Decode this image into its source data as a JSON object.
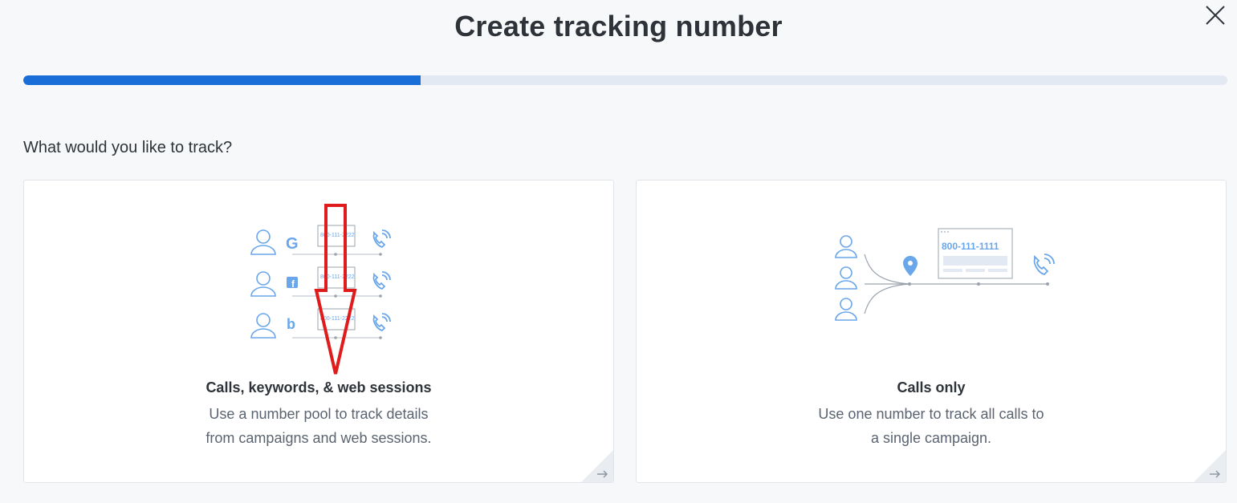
{
  "modal": {
    "title": "Create tracking number",
    "close_icon": "close-icon",
    "progress_percent": 33
  },
  "question": "What would you like to track?",
  "options": [
    {
      "title": "Calls, keywords, & web sessions",
      "desc_line1": "Use a number pool to track details",
      "desc_line2": "from campaigns and web sessions.",
      "illustration_number": "800-111-2222",
      "icons": [
        "person-icon",
        "google-icon",
        "facebook-icon",
        "bing-icon",
        "phone-icon",
        "arrow-right-icon"
      ]
    },
    {
      "title": "Calls only",
      "desc_line1": "Use one number to track all calls to",
      "desc_line2": "a single campaign.",
      "illustration_number": "800-111-1111",
      "icons": [
        "person-icon",
        "location-pin-icon",
        "phone-icon",
        "arrow-right-icon"
      ]
    }
  ],
  "colors": {
    "accent": "#1a6ed8",
    "track": "#e3e9f2",
    "illustration_blue": "#6aa6ea",
    "annotation_red": "#e01b1b"
  }
}
